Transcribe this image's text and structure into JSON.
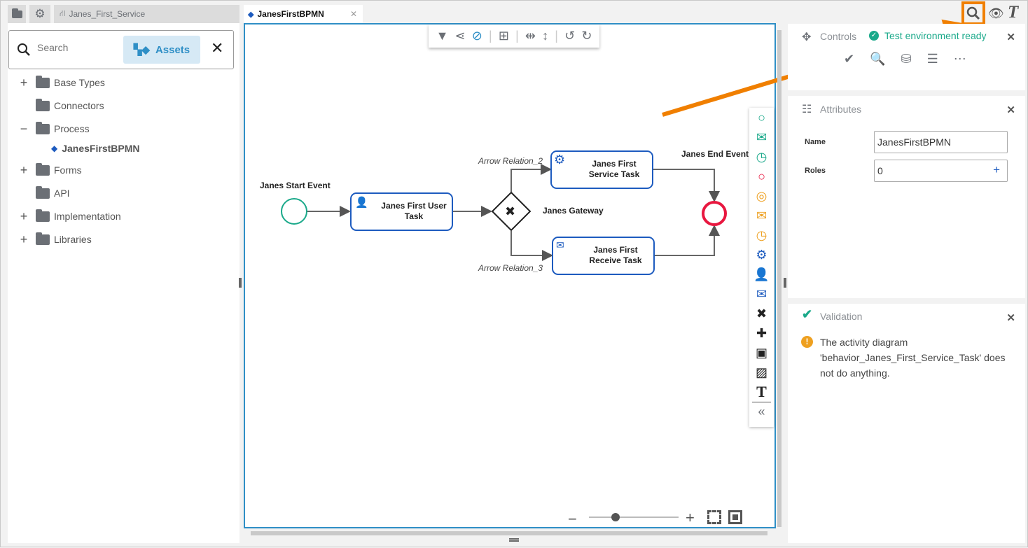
{
  "tabs": {
    "project": "Janes_First_Service",
    "editor": "JanesFirstBPMN"
  },
  "search": {
    "placeholder": "Search",
    "assets_label": "Assets"
  },
  "tree": [
    {
      "label": "Base Types",
      "expander": "+"
    },
    {
      "label": "Connectors",
      "expander": ""
    },
    {
      "label": "Process",
      "expander": "−"
    },
    {
      "label": "JanesFirstBPMN",
      "expander": ""
    },
    {
      "label": "Forms",
      "expander": "+"
    },
    {
      "label": "API",
      "expander": ""
    },
    {
      "label": "Implementation",
      "expander": "+"
    },
    {
      "label": "Libraries",
      "expander": "+"
    }
  ],
  "diagram": {
    "start_event": "Janes Start Event",
    "user_task": [
      "Janes First User",
      "Task"
    ],
    "gateway": "Janes Gateway",
    "service_task": [
      "Janes First",
      "Service Task"
    ],
    "receive_task": [
      "Janes First",
      "Receive Task"
    ],
    "end_event": "Janes End Event",
    "arrow2": "Arrow Relation_2",
    "arrow3": "Arrow Relation_3"
  },
  "controls": {
    "title": "Controls",
    "status": "Test environment ready",
    "status_color": "#1aa98a"
  },
  "attributes": {
    "title": "Attributes",
    "name_label": "Name",
    "name_value": "JanesFirstBPMN",
    "roles_label": "Roles",
    "roles_value": "0"
  },
  "validation": {
    "title": "Validation",
    "message": "The activity diagram 'behavior_Janes_First_Service_Task' does not do anything."
  },
  "colors": {
    "accent": "#2f8fc6",
    "highlight": "#f07f00",
    "start": "#1aa98a",
    "end": "#e8173f",
    "task": "#1d5bbf"
  }
}
